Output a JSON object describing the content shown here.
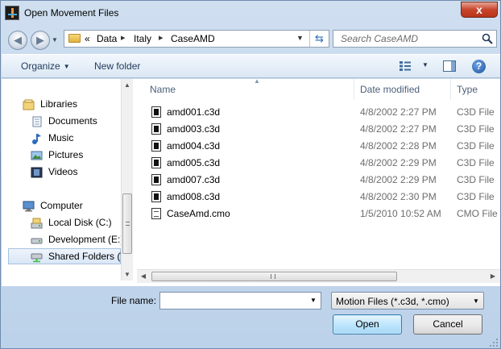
{
  "window": {
    "title": "Open Movement Files",
    "close_glyph": "x"
  },
  "address": {
    "overflow": "«",
    "crumbs": [
      "Data",
      "Italy",
      "CaseAMD"
    ],
    "separator": "▸"
  },
  "search": {
    "placeholder": "Search CaseAMD"
  },
  "toolbar": {
    "organize_label": "Organize",
    "new_folder_label": "New folder",
    "help_glyph": "?"
  },
  "nav": {
    "items": [
      {
        "label": "Libraries",
        "icon": "libraries-icon"
      },
      {
        "label": "Documents",
        "icon": "documents-icon"
      },
      {
        "label": "Music",
        "icon": "music-icon"
      },
      {
        "label": "Pictures",
        "icon": "pictures-icon"
      },
      {
        "label": "Videos",
        "icon": "videos-icon"
      },
      {
        "label": "Computer",
        "icon": "computer-icon"
      },
      {
        "label": "Local Disk (C:)",
        "icon": "local-disk-icon"
      },
      {
        "label": "Development (E:)",
        "icon": "drive-icon"
      },
      {
        "label": "Shared Folders (\\\\",
        "icon": "network-drive-icon",
        "selected": true
      }
    ]
  },
  "files": {
    "columns": {
      "name": "Name",
      "date": "Date modified",
      "type": "Type"
    },
    "rows": [
      {
        "name": "amd001.c3d",
        "date": "4/8/2002 2:27 PM",
        "type": "C3D File"
      },
      {
        "name": "amd003.c3d",
        "date": "4/8/2002 2:27 PM",
        "type": "C3D File"
      },
      {
        "name": "amd004.c3d",
        "date": "4/8/2002 2:28 PM",
        "type": "C3D File"
      },
      {
        "name": "amd005.c3d",
        "date": "4/8/2002 2:29 PM",
        "type": "C3D File"
      },
      {
        "name": "amd007.c3d",
        "date": "4/8/2002 2:29 PM",
        "type": "C3D File"
      },
      {
        "name": "amd008.c3d",
        "date": "4/8/2002 2:30 PM",
        "type": "C3D File"
      },
      {
        "name": "CaseAmd.cmo",
        "date": "1/5/2010 10:52 AM",
        "type": "CMO File"
      }
    ]
  },
  "bottom": {
    "filename_label": "File name:",
    "filename_value": "",
    "filetype_value": "Motion Files (*.c3d, *.cmo)",
    "open_label": "Open",
    "cancel_label": "Cancel"
  }
}
